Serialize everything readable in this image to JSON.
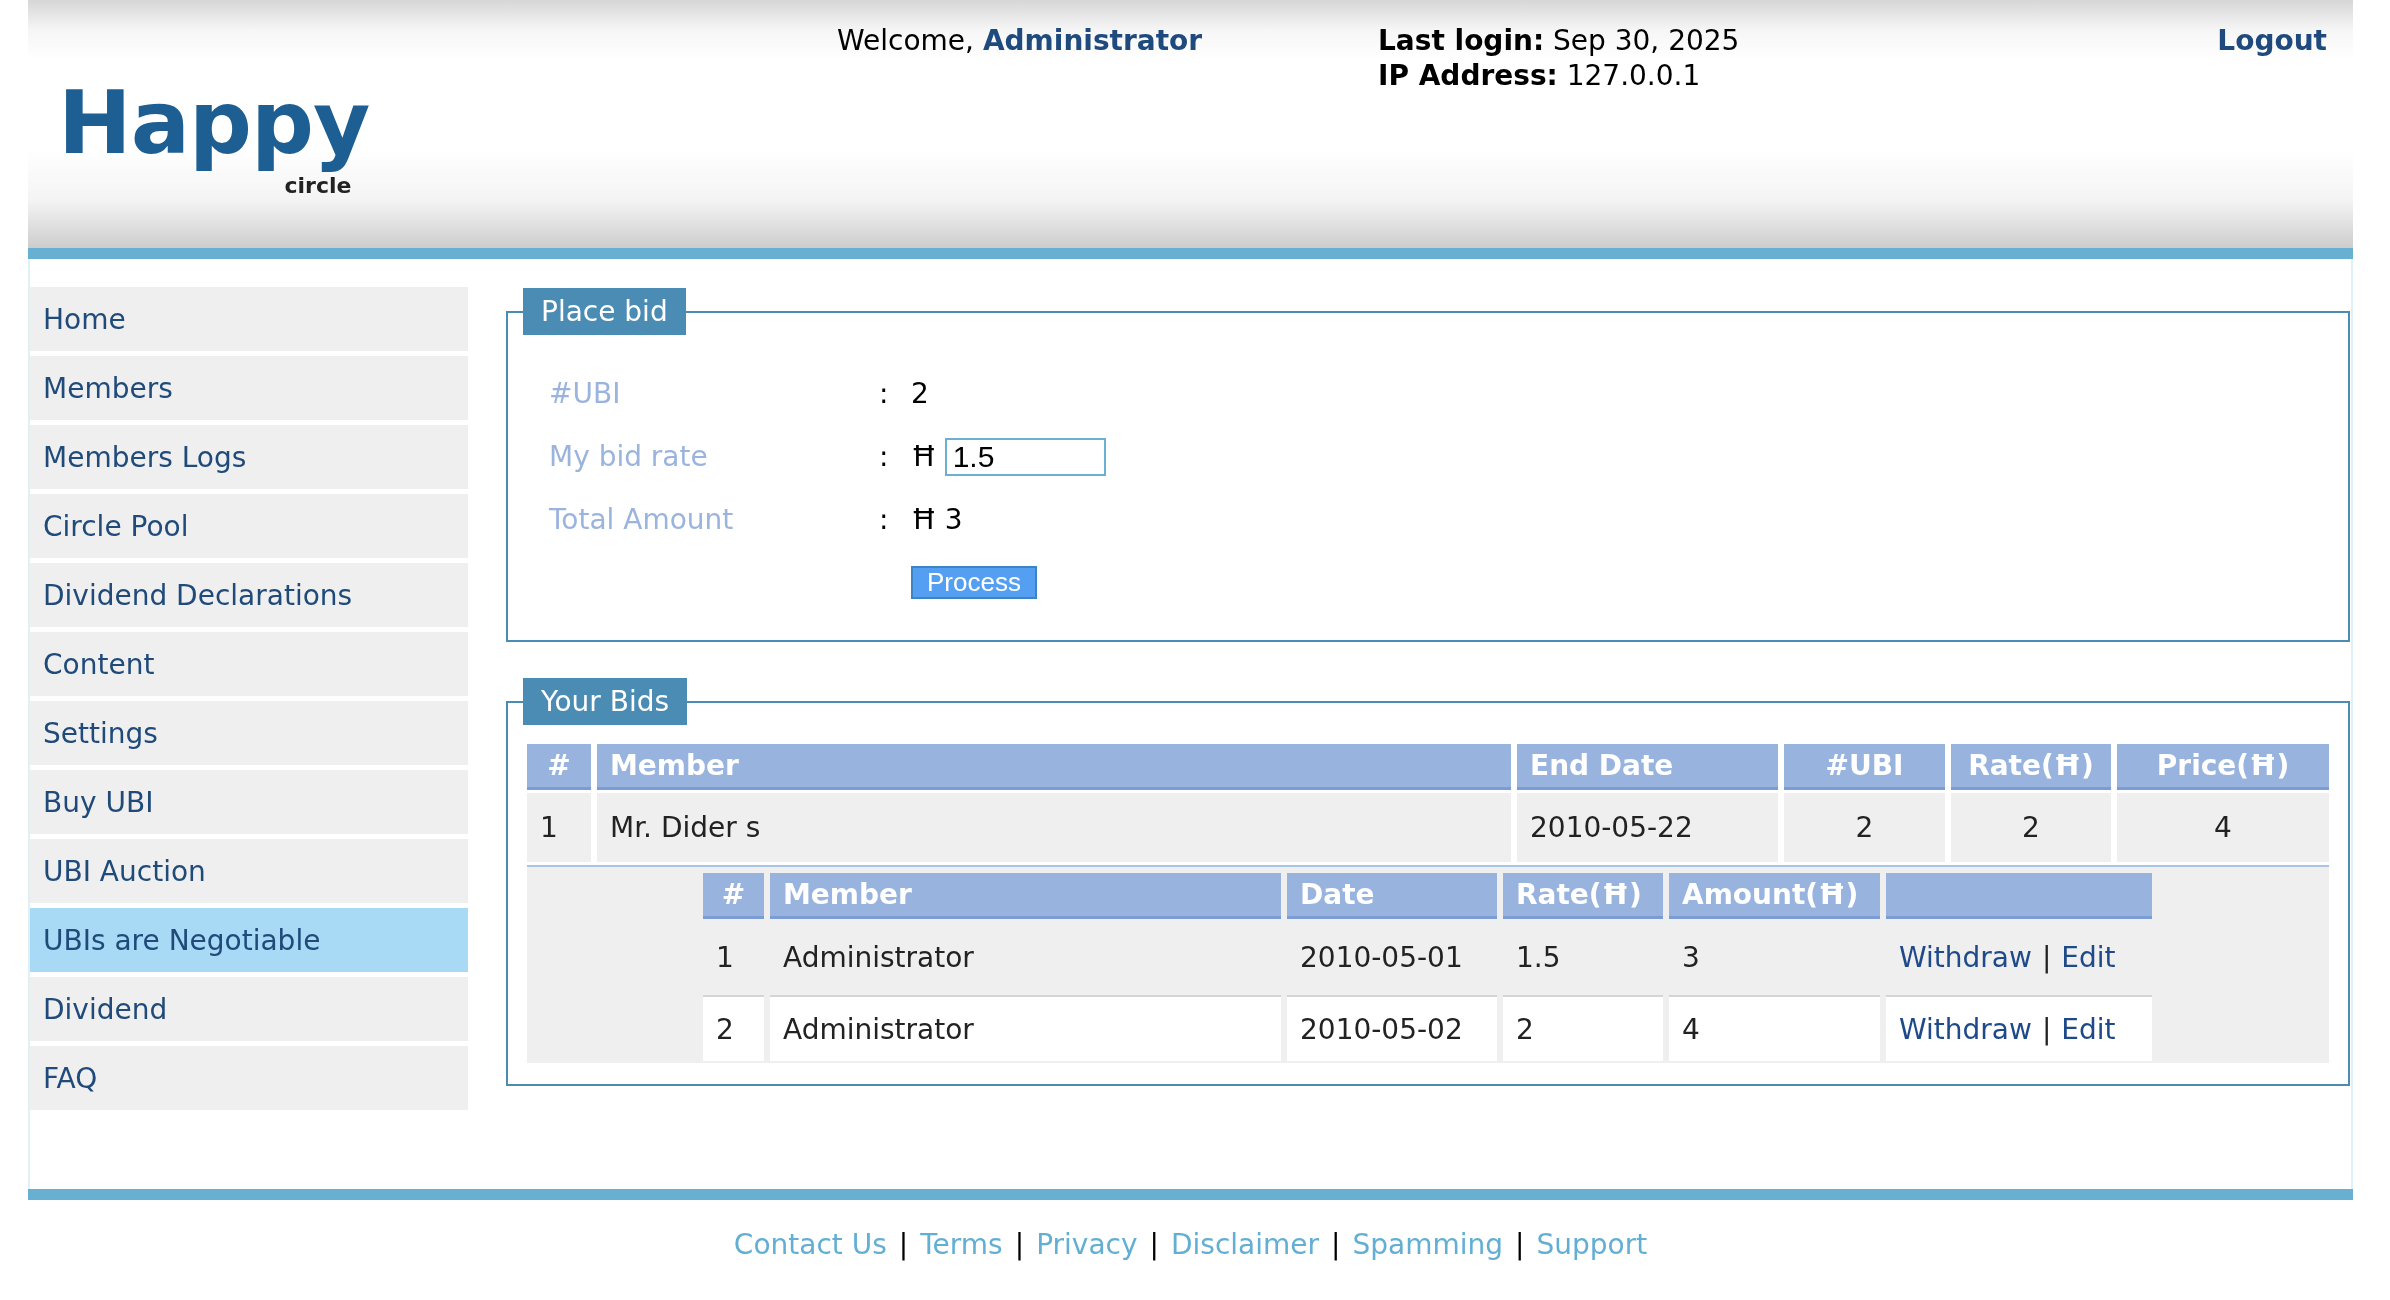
{
  "header": {
    "logo": {
      "title": "Happy",
      "subtitle": "circle"
    },
    "welcome": {
      "text": "Welcome,",
      "user": "Administrator"
    },
    "last_login": "**Last login:** Sep 30, 2025",
    "ip_address": "**IP Address:** 127.0.0.1",
    "logout": "Logout"
  },
  "sidebar": {
    "items": [
      {
        "label": "Home",
        "selected": false
      },
      {
        "label": "Members",
        "selected": false
      },
      {
        "label": "Members Logs",
        "selected": false
      },
      {
        "label": "Circle Pool",
        "selected": false
      },
      {
        "label": "Dividend Declarations",
        "selected": false
      },
      {
        "label": "Content",
        "selected": false
      },
      {
        "label": "Settings",
        "selected": false
      },
      {
        "label": "Buy UBI",
        "selected": false
      },
      {
        "label": "UBI Auction",
        "selected": false
      },
      {
        "label": "UBIs are Negotiable",
        "selected": true
      },
      {
        "label": "Dividend",
        "selected": false
      },
      {
        "label": "FAQ",
        "selected": false
      }
    ]
  },
  "place_bid": {
    "title": "Place bid",
    "fields": [
      {
        "kind": "text",
        "label": "#UBI",
        "separator": ":",
        "value": "2"
      },
      {
        "kind": "input",
        "label": "My bid rate",
        "separator": ":",
        "currency": "Ħ",
        "value": "1.5"
      },
      {
        "kind": "text",
        "label": "Total Amount",
        "separator": ":",
        "currency": "Ħ",
        "value": "3"
      }
    ],
    "button": "Process"
  },
  "your_bids": {
    "title": "Your Bids",
    "columns": [
      "#",
      "Member",
      "End Date",
      "#UBI",
      "Rate(Ħ)",
      "Price(Ħ)"
    ],
    "rows": [
      {
        "cells": [
          "1",
          "Mr. Dider s",
          "2010-05-22",
          "2",
          "2",
          "4"
        ],
        "bids": {
          "columns": [
            "#",
            "Member",
            "Date",
            "Rate(Ħ)",
            "Amount(Ħ)"
          ],
          "rows": [
            {
              "cells": [
                "1",
                "Administrator",
                "2010-05-01",
                "1.5",
                "3"
              ],
              "actions": [
                "Withdraw",
                "Edit"
              ],
              "separator": "|"
            },
            {
              "cells": [
                "2",
                "Administrator",
                "2010-05-02",
                "2",
                "4"
              ],
              "actions": [
                "Withdraw",
                "Edit"
              ],
              "separator": "|"
            }
          ]
        }
      }
    ]
  },
  "footer": {
    "links": [
      "Contact Us",
      "Terms",
      "Privacy",
      "Disclaimer",
      "Spamming",
      "Support"
    ],
    "separator": "|"
  }
}
